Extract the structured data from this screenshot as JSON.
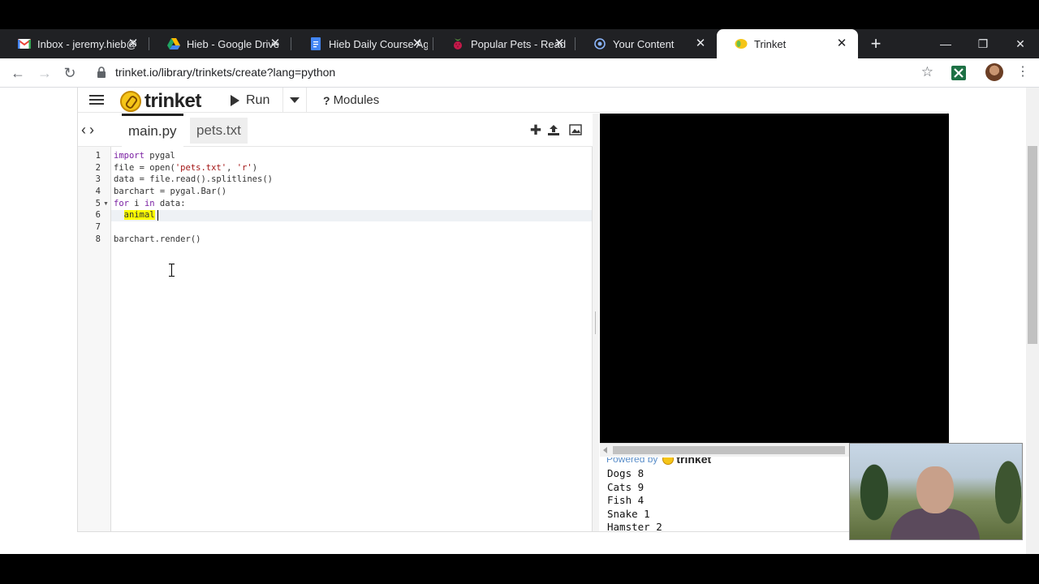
{
  "browser": {
    "tabs": [
      {
        "title": "Inbox - jeremy.hieb@",
        "icon": "gmail-icon",
        "color": "#ea4335"
      },
      {
        "title": "Hieb - Google Drive",
        "icon": "google-drive-icon",
        "color": "#1fa463"
      },
      {
        "title": "Hieb Daily Course Ag",
        "icon": "google-docs-icon",
        "color": "#4285f4"
      },
      {
        "title": "Popular Pets - Read",
        "icon": "raspberry-pi-icon",
        "color": "#c51a4a"
      },
      {
        "title": "Your Content",
        "icon": "circle-icon",
        "color": "#4a90d9"
      },
      {
        "title": "Trinket",
        "icon": "trinket-icon",
        "color": "#f5c518"
      }
    ],
    "active_tab": 5,
    "url": "trinket.io/library/trinkets/create?lang=python"
  },
  "trinket": {
    "logo_text": "trinket",
    "run_label": "Run",
    "modules_label": "Modules",
    "file_tabs": [
      "main.py",
      "pets.txt"
    ],
    "active_file": "main.py",
    "code_lines": [
      {
        "n": "1",
        "text": "import pygal"
      },
      {
        "n": "2",
        "text": "file = open('pets.txt', 'r')"
      },
      {
        "n": "3",
        "text": "data = file.read().splitlines()"
      },
      {
        "n": "4",
        "text": "barchart = pygal.Bar()"
      },
      {
        "n": "5",
        "text": "for i in data:"
      },
      {
        "n": "6",
        "text": "  animal"
      },
      {
        "n": "7",
        "text": ""
      },
      {
        "n": "8",
        "text": "barchart.render()"
      }
    ],
    "powered_by": "Powered by",
    "output_lines": [
      "Dogs 8",
      "Cats 9",
      "Fish 4",
      "Snake 1",
      "Hamster 2"
    ]
  }
}
